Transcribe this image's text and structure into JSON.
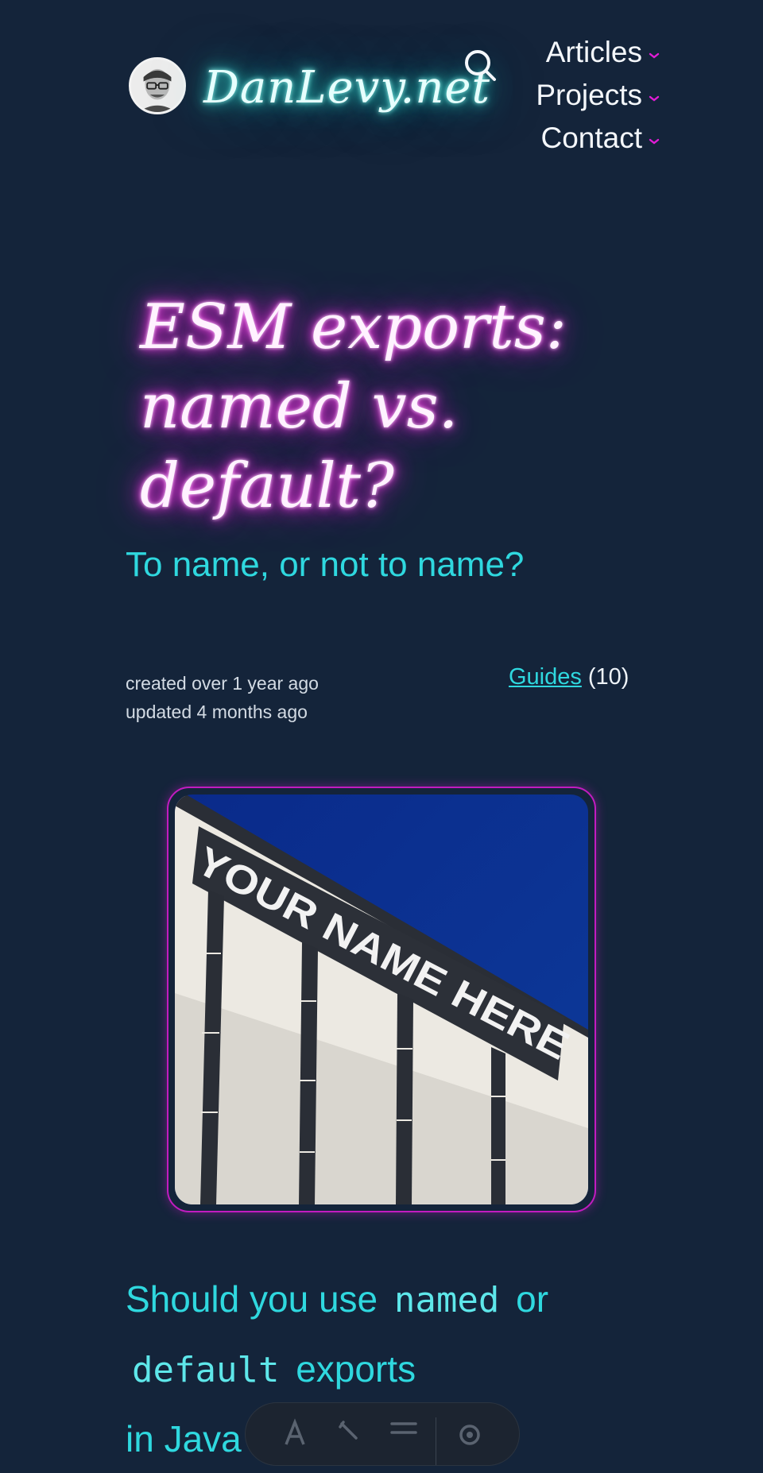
{
  "header": {
    "logo_text": "DanLevy.net",
    "nav": [
      {
        "label": "Articles"
      },
      {
        "label": "Projects"
      },
      {
        "label": "Contact"
      }
    ]
  },
  "article": {
    "title_line1": "ESM exports:",
    "title_line2": "named vs. default?",
    "subtitle": "To name, or not to name?",
    "meta": {
      "created": "created over 1 year ago",
      "updated": "updated 4 months ago",
      "category": "Guides",
      "category_count": "(10)"
    },
    "image": {
      "banner_text": "YOUR NAME HERE"
    },
    "heading": {
      "part1": "Should you use",
      "code1": "named",
      "part2": "or",
      "code2": "default",
      "part3": "exports",
      "part4": "in Java"
    }
  },
  "colors": {
    "background": "#14243a",
    "accent_cyan": "#2fd8df",
    "accent_magenta": "#e21cd6"
  },
  "icons": [
    "avatar-image",
    "search-icon",
    "chevron-down-icon",
    "text-size-icon",
    "brush-icon",
    "menu-icon",
    "settings-icon"
  ]
}
